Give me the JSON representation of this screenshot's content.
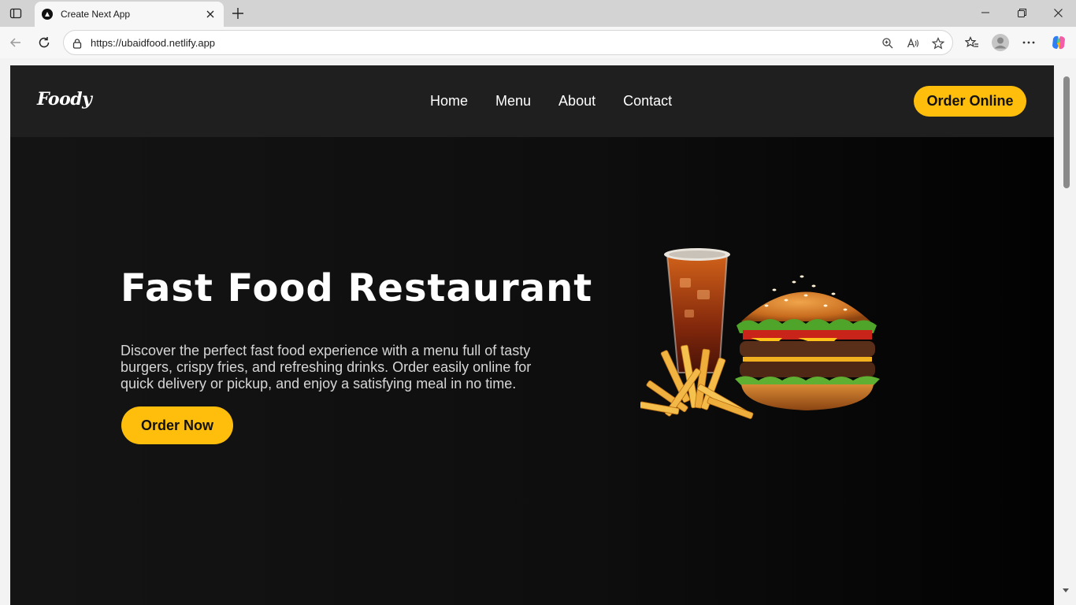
{
  "browser": {
    "tab_title": "Create Next App",
    "url": "https://ubaidfood.netlify.app"
  },
  "site": {
    "logo": "Foody",
    "nav": [
      "Home",
      "Menu",
      "About",
      "Contact"
    ],
    "cta_header": "Order Online",
    "hero": {
      "title": "Fast Food Restaurant",
      "description": "Discover the perfect fast food experience with a menu full of tasty burgers, crispy fries, and refreshing drinks. Order easily online for quick delivery or pickup, and enjoy a satisfying meal in no time.",
      "cta": "Order Now",
      "image": "burger-fries-drink-image"
    }
  },
  "colors": {
    "accent": "#ffbe0b",
    "header_bg": "#1f1f1f",
    "hero_bg": "#0e0e0e"
  }
}
